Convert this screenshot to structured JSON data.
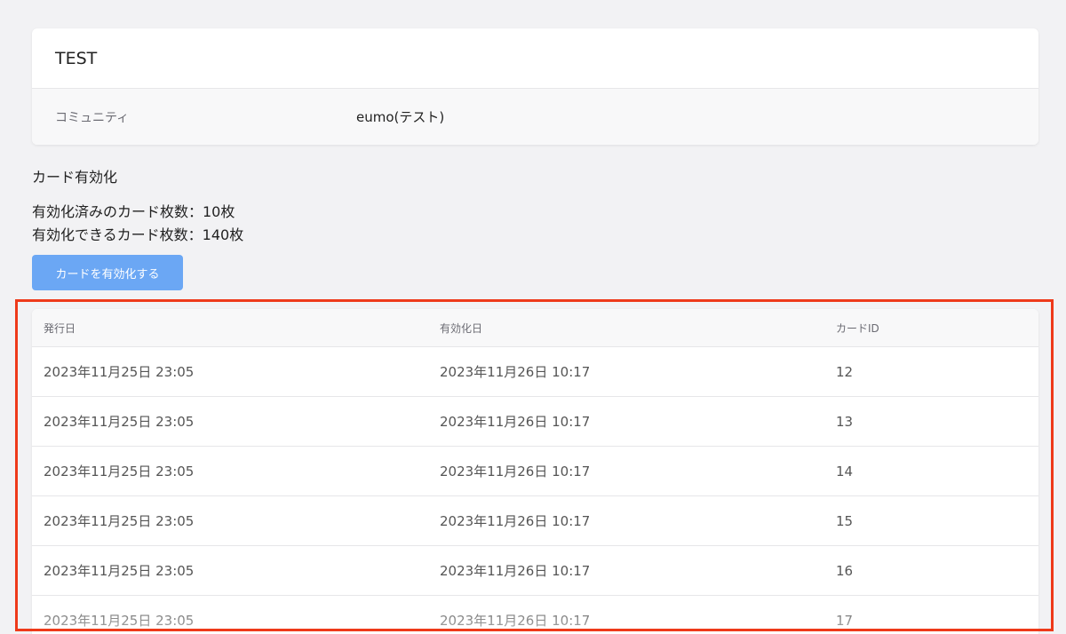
{
  "community_card": {
    "title": "TEST",
    "label": "コミュニティ",
    "value": "eumo(テスト)"
  },
  "section": {
    "title": "カード有効化",
    "activated_line": "有効化済みのカード枚数：10枚",
    "available_line": "有効化できるカード枚数：140枚",
    "activate_button": "カードを有効化する"
  },
  "table": {
    "headers": [
      "発行日",
      "有効化日",
      "カードID"
    ],
    "rows": [
      [
        "2023年11月25日 23:05",
        "2023年11月26日 10:17",
        "12"
      ],
      [
        "2023年11月25日 23:05",
        "2023年11月26日 10:17",
        "13"
      ],
      [
        "2023年11月25日 23:05",
        "2023年11月26日 10:17",
        "14"
      ],
      [
        "2023年11月25日 23:05",
        "2023年11月26日 10:17",
        "15"
      ],
      [
        "2023年11月25日 23:05",
        "2023年11月26日 10:17",
        "16"
      ],
      [
        "2023年11月25日 23:05",
        "2023年11月26日 10:17",
        "17"
      ]
    ]
  },
  "colors": {
    "button": "#6ba7f4",
    "highlight": "#ee3a1a",
    "background": "#f2f2f4"
  }
}
